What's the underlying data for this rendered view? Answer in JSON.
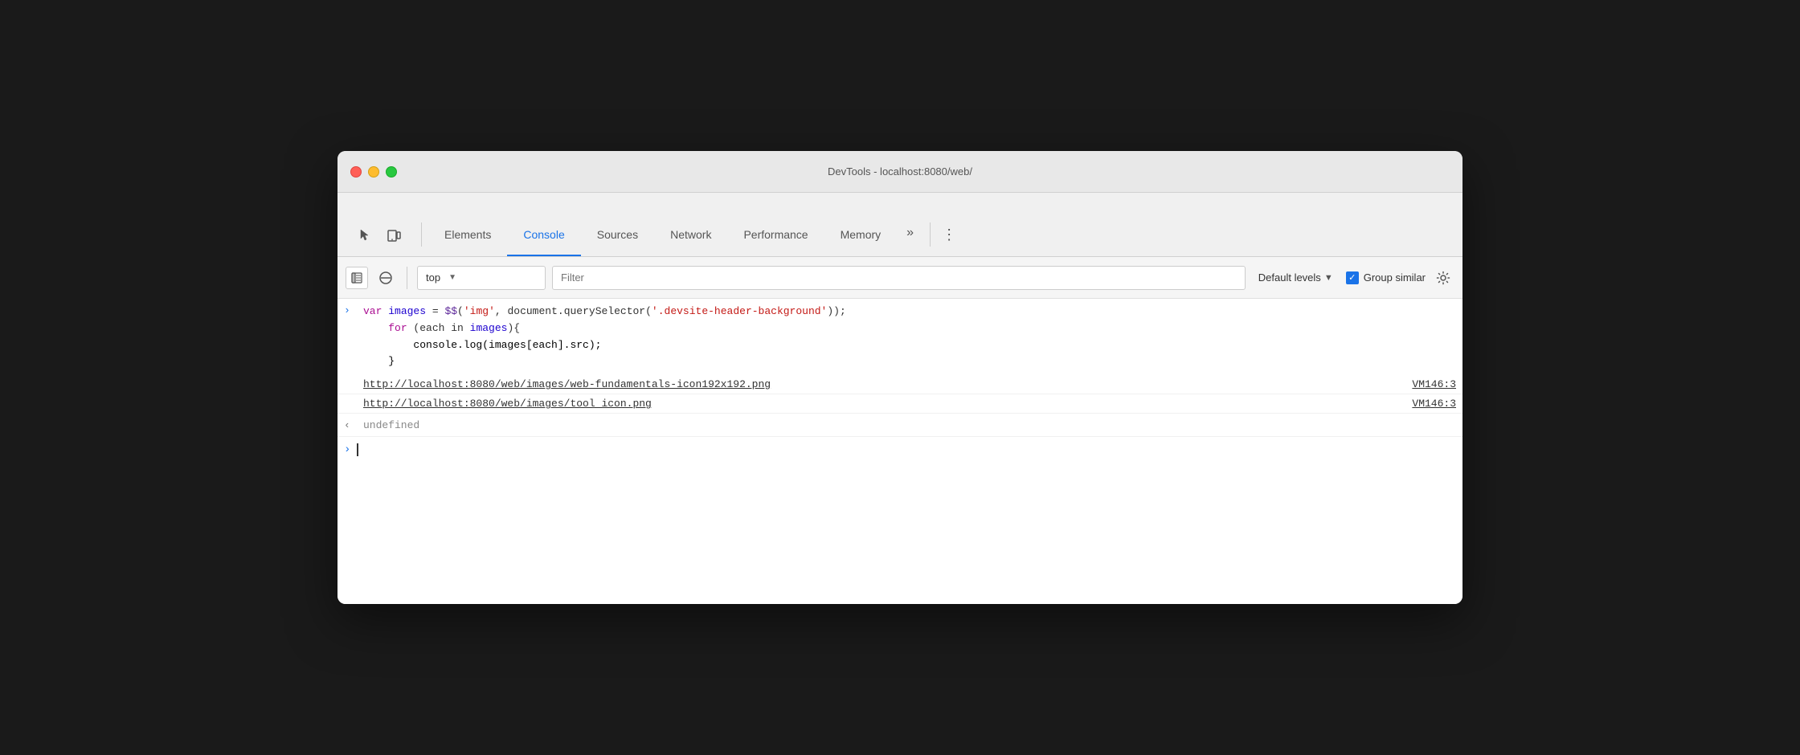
{
  "window": {
    "title": "DevTools - localhost:8080/web/"
  },
  "titlebar": {
    "title": "DevTools - localhost:8080/web/"
  },
  "tabs": {
    "items": [
      {
        "id": "elements",
        "label": "Elements",
        "active": false
      },
      {
        "id": "console",
        "label": "Console",
        "active": true
      },
      {
        "id": "sources",
        "label": "Sources",
        "active": false
      },
      {
        "id": "network",
        "label": "Network",
        "active": false
      },
      {
        "id": "performance",
        "label": "Performance",
        "active": false
      },
      {
        "id": "memory",
        "label": "Memory",
        "active": false
      }
    ],
    "more_label": "»",
    "menu_label": "⋮"
  },
  "filterbar": {
    "dropdown_value": "top",
    "dropdown_arrow": "▼",
    "filter_placeholder": "Filter",
    "default_levels_label": "Default levels",
    "default_levels_arrow": "▼",
    "group_similar_label": "Group similar",
    "checkbox_checked": true
  },
  "console": {
    "code_line1_var": "var ",
    "code_line1_varname": "images",
    "code_line1_op": " = ",
    "code_line1_fn": "$$",
    "code_line1_paren1": "(",
    "code_line1_str1": "'img'",
    "code_line1_comma": ", document.querySelector(",
    "code_line1_str2": "'.devsite-header-background'",
    "code_line1_end": "));",
    "code_line2": "    for (each in images){",
    "code_line2_for": "for",
    "code_line2_rest": " (each in images){",
    "code_line3_indent": "        console.log(images[each].src);",
    "code_line4": "    }",
    "link1": "http://localhost:8080/web/images/web-fundamentals-icon192x192.png",
    "link1_source": "VM146:3",
    "link2": "http://localhost:8080/web/images/tool_icon.png",
    "link2_source": "VM146:3",
    "undefined_text": "undefined"
  }
}
